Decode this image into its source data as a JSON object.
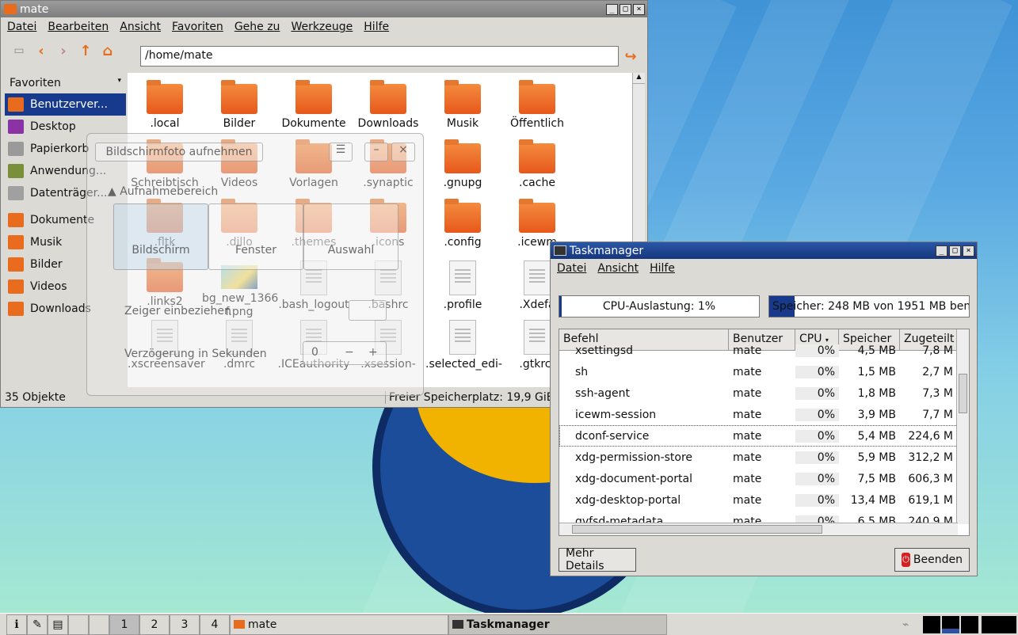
{
  "file_manager": {
    "title": "mate",
    "menu": [
      "Datei",
      "Bearbeiten",
      "Ansicht",
      "Favoriten",
      "Gehe zu",
      "Werkzeuge",
      "Hilfe"
    ],
    "location": "/home/mate",
    "sidebar_heading": "Favoriten",
    "sidebar_items": [
      {
        "label": "Benutzerver...",
        "icon": "home-icon",
        "color": "#e96c1e"
      },
      {
        "label": "Desktop",
        "icon": "desktop-icon",
        "color": "#8b33a6"
      },
      {
        "label": "Papierkorb",
        "icon": "trash-icon",
        "color": "#9a9a9a"
      },
      {
        "label": "Anwendung...",
        "icon": "applications-icon",
        "color": "#7a8f3a"
      },
      {
        "label": "Datenträger...",
        "icon": "usb-drive-icon",
        "color": "#a0a0a0"
      },
      {
        "label": "Dokumente",
        "icon": "folder-documents-icon",
        "color": "#e96c1e"
      },
      {
        "label": "Musik",
        "icon": "folder-music-icon",
        "color": "#e96c1e"
      },
      {
        "label": "Bilder",
        "icon": "folder-pictures-icon",
        "color": "#e96c1e"
      },
      {
        "label": "Videos",
        "icon": "folder-videos-icon",
        "color": "#e96c1e"
      },
      {
        "label": "Downloads",
        "icon": "folder-downloads-icon",
        "color": "#e96c1e"
      }
    ],
    "files": [
      {
        "name": ".local",
        "type": "folder"
      },
      {
        "name": "Bilder",
        "type": "folder"
      },
      {
        "name": "Dokumente",
        "type": "folder"
      },
      {
        "name": "Downloads",
        "type": "folder"
      },
      {
        "name": "Musik",
        "type": "folder"
      },
      {
        "name": "Öffentlich",
        "type": "folder"
      },
      {
        "name": "Schreibtisch",
        "type": "folder"
      },
      {
        "name": "Videos",
        "type": "folder"
      },
      {
        "name": "Vorlagen",
        "type": "folder"
      },
      {
        "name": ".synaptic",
        "type": "folder"
      },
      {
        "name": ".gnupg",
        "type": "folder"
      },
      {
        "name": ".cache",
        "type": "folder"
      },
      {
        "name": ".fltk",
        "type": "folder"
      },
      {
        "name": ".dillo",
        "type": "folder"
      },
      {
        "name": ".themes",
        "type": "folder"
      },
      {
        "name": ".icons",
        "type": "folder"
      },
      {
        "name": ".config",
        "type": "folder"
      },
      {
        "name": ".icewm",
        "type": "folder"
      },
      {
        "name": ".links2",
        "type": "folder"
      },
      {
        "name": "bg_new_1366 f.png",
        "type": "image"
      },
      {
        "name": ".bash_logout",
        "type": "doc"
      },
      {
        "name": ".bashrc",
        "type": "doc"
      },
      {
        "name": ".profile",
        "type": "doc"
      },
      {
        "name": ".Xdefa",
        "type": "doc"
      },
      {
        "name": ".xscreensaver",
        "type": "doc"
      },
      {
        "name": ".dmrc",
        "type": "doc"
      },
      {
        "name": ".ICEauthority",
        "type": "doc"
      },
      {
        "name": ".xsession-",
        "type": "doc"
      },
      {
        "name": ".selected_edi-",
        "type": "doc"
      },
      {
        "name": ".gtkrc-",
        "type": "doc"
      }
    ],
    "status_left": "35 Objekte",
    "status_right": "Freier Speicherplatz: 19,9 GiB (Ge"
  },
  "screenshot_tool": {
    "button": "Bildschirmfoto aufnehmen",
    "section": "Aufnahmebereich",
    "modes": [
      "Bildschirm",
      "Fenster",
      "Auswahl"
    ],
    "pointer_label": "Zeiger einbeziehen",
    "delay_label": "Verzögerung in Sekunden",
    "delay_value": "0"
  },
  "task_manager": {
    "title": "Taskmanager",
    "menu": [
      "Datei",
      "Ansicht",
      "Hilfe"
    ],
    "cpu_text": "CPU-Auslastung: 1%",
    "cpu_fraction": 0.01,
    "mem_text": "Speicher: 248 MB von 1951 MB benutzt",
    "mem_fraction": 0.127,
    "columns": [
      "Befehl",
      "Benutzer",
      "CPU",
      "Speicher",
      "Zugeteilt"
    ],
    "rows": [
      [
        "xsettingsd",
        "mate",
        "0%",
        "4,5 MB",
        "7,8 M"
      ],
      [
        "sh",
        "mate",
        "0%",
        "1,5 MB",
        "2,7 M"
      ],
      [
        "ssh-agent",
        "mate",
        "0%",
        "1,8 MB",
        "7,3 M"
      ],
      [
        "icewm-session",
        "mate",
        "0%",
        "3,9 MB",
        "7,7 M"
      ],
      [
        "dconf-service",
        "mate",
        "0%",
        "5,4 MB",
        "224,6 M"
      ],
      [
        "xdg-permission-store",
        "mate",
        "0%",
        "5,9 MB",
        "312,2 M"
      ],
      [
        "xdg-document-portal",
        "mate",
        "0%",
        "7,5 MB",
        "606,3 M"
      ],
      [
        "xdg-desktop-portal",
        "mate",
        "0%",
        "13,4 MB",
        "619,1 M"
      ],
      [
        "gvfsd-metadata",
        "mate",
        "0%",
        "6,5 MB",
        "240,9 M"
      ]
    ],
    "details_button": "Mehr Details",
    "end_button": "Beenden"
  },
  "taskbar": {
    "workspaces": [
      "1",
      "2",
      "3",
      "4"
    ],
    "tasks": [
      "mate",
      "Taskmanager"
    ]
  }
}
